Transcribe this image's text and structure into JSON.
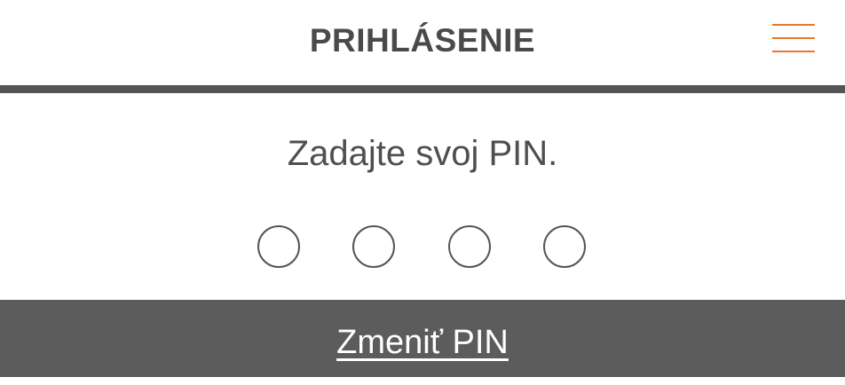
{
  "header": {
    "title": "PRIHLÁSENIE",
    "menu_icon": "hamburger-menu-icon",
    "menu_color": "#e8762d"
  },
  "main": {
    "instruction": "Zadajte svoj PIN.",
    "pin_length": 4,
    "pin_filled": 0
  },
  "footer": {
    "change_pin_label": "Zmeniť PIN",
    "background": "#5c5c5c"
  }
}
